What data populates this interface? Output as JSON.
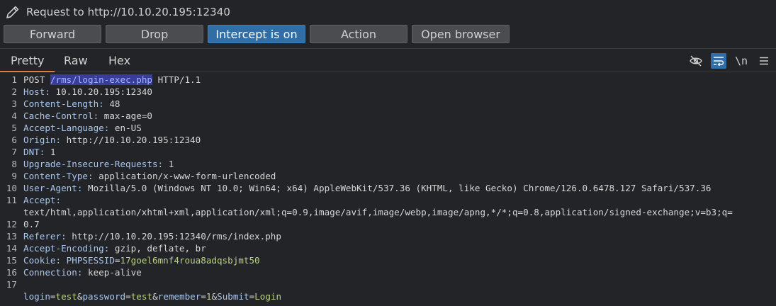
{
  "window": {
    "title": "Request to http://10.10.20.195:12340"
  },
  "toolbar": {
    "forward": "Forward",
    "drop": "Drop",
    "intercept": "Intercept is on",
    "action": "Action",
    "open_browser": "Open browser"
  },
  "tabs": {
    "pretty": "Pretty",
    "raw": "Raw",
    "hex": "Hex",
    "newline": "\\n"
  },
  "request": {
    "line1": {
      "method": "POST ",
      "path": "/rms/login-exec.php",
      "proto": " HTTP/1.1"
    },
    "h2": {
      "name": "Host:",
      "value": " 10.10.20.195:12340"
    },
    "h3": {
      "name": "Content-Length:",
      "value": " 48"
    },
    "h4": {
      "name": "Cache-Control:",
      "value": " max-age=0"
    },
    "h5": {
      "name": "Accept-Language:",
      "value": " en-US"
    },
    "h6": {
      "name": "Origin:",
      "value": " http://10.10.20.195:12340"
    },
    "h7": {
      "name": "DNT:",
      "value": " 1"
    },
    "h8": {
      "name": "Upgrade-Insecure-Requests:",
      "value": " 1"
    },
    "h9": {
      "name": "Content-Type:",
      "value": " application/x-www-form-urlencoded"
    },
    "h10": {
      "name": "User-Agent:",
      "value": " Mozilla/5.0 (Windows NT 10.0; Win64; x64) AppleWebKit/537.36 (KHTML, like Gecko) Chrome/126.0.6478.127 Safari/537.36"
    },
    "h11": {
      "name": "Accept:",
      "wrap1": "text/html,application/xhtml+xml,application/xml;q=0.9,image/avif,image/webp,image/apng,*/*;q=0.8,application/signed-exchange;v=b3;q=",
      "wrap2": "0.7"
    },
    "h12": {
      "name": "Referer:",
      "value": " http://10.10.20.195:12340/rms/index.php"
    },
    "h13": {
      "name": "Accept-Encoding:",
      "value": " gzip, deflate, br"
    },
    "h14": {
      "name": "Cookie:",
      "cookie_name": " PHPSESSID",
      "eq": "=",
      "cookie_value": "17goel6mnf4roua8adqsbjmt50"
    },
    "h15": {
      "name": "Connection:",
      "value": " keep-alive"
    },
    "body": {
      "p1n": "login",
      "p1v": "test",
      "p2n": "password",
      "p2v": "test",
      "p3n": "remember",
      "p3v": "1",
      "p4n": "Submit",
      "p4v": "Login",
      "eq": "=",
      "amp": "&"
    }
  },
  "line_numbers": [
    "1",
    "2",
    "3",
    "4",
    "5",
    "6",
    "7",
    "8",
    "9",
    "10",
    "11",
    "",
    "12",
    "13",
    "14",
    "15",
    "16",
    "17"
  ]
}
